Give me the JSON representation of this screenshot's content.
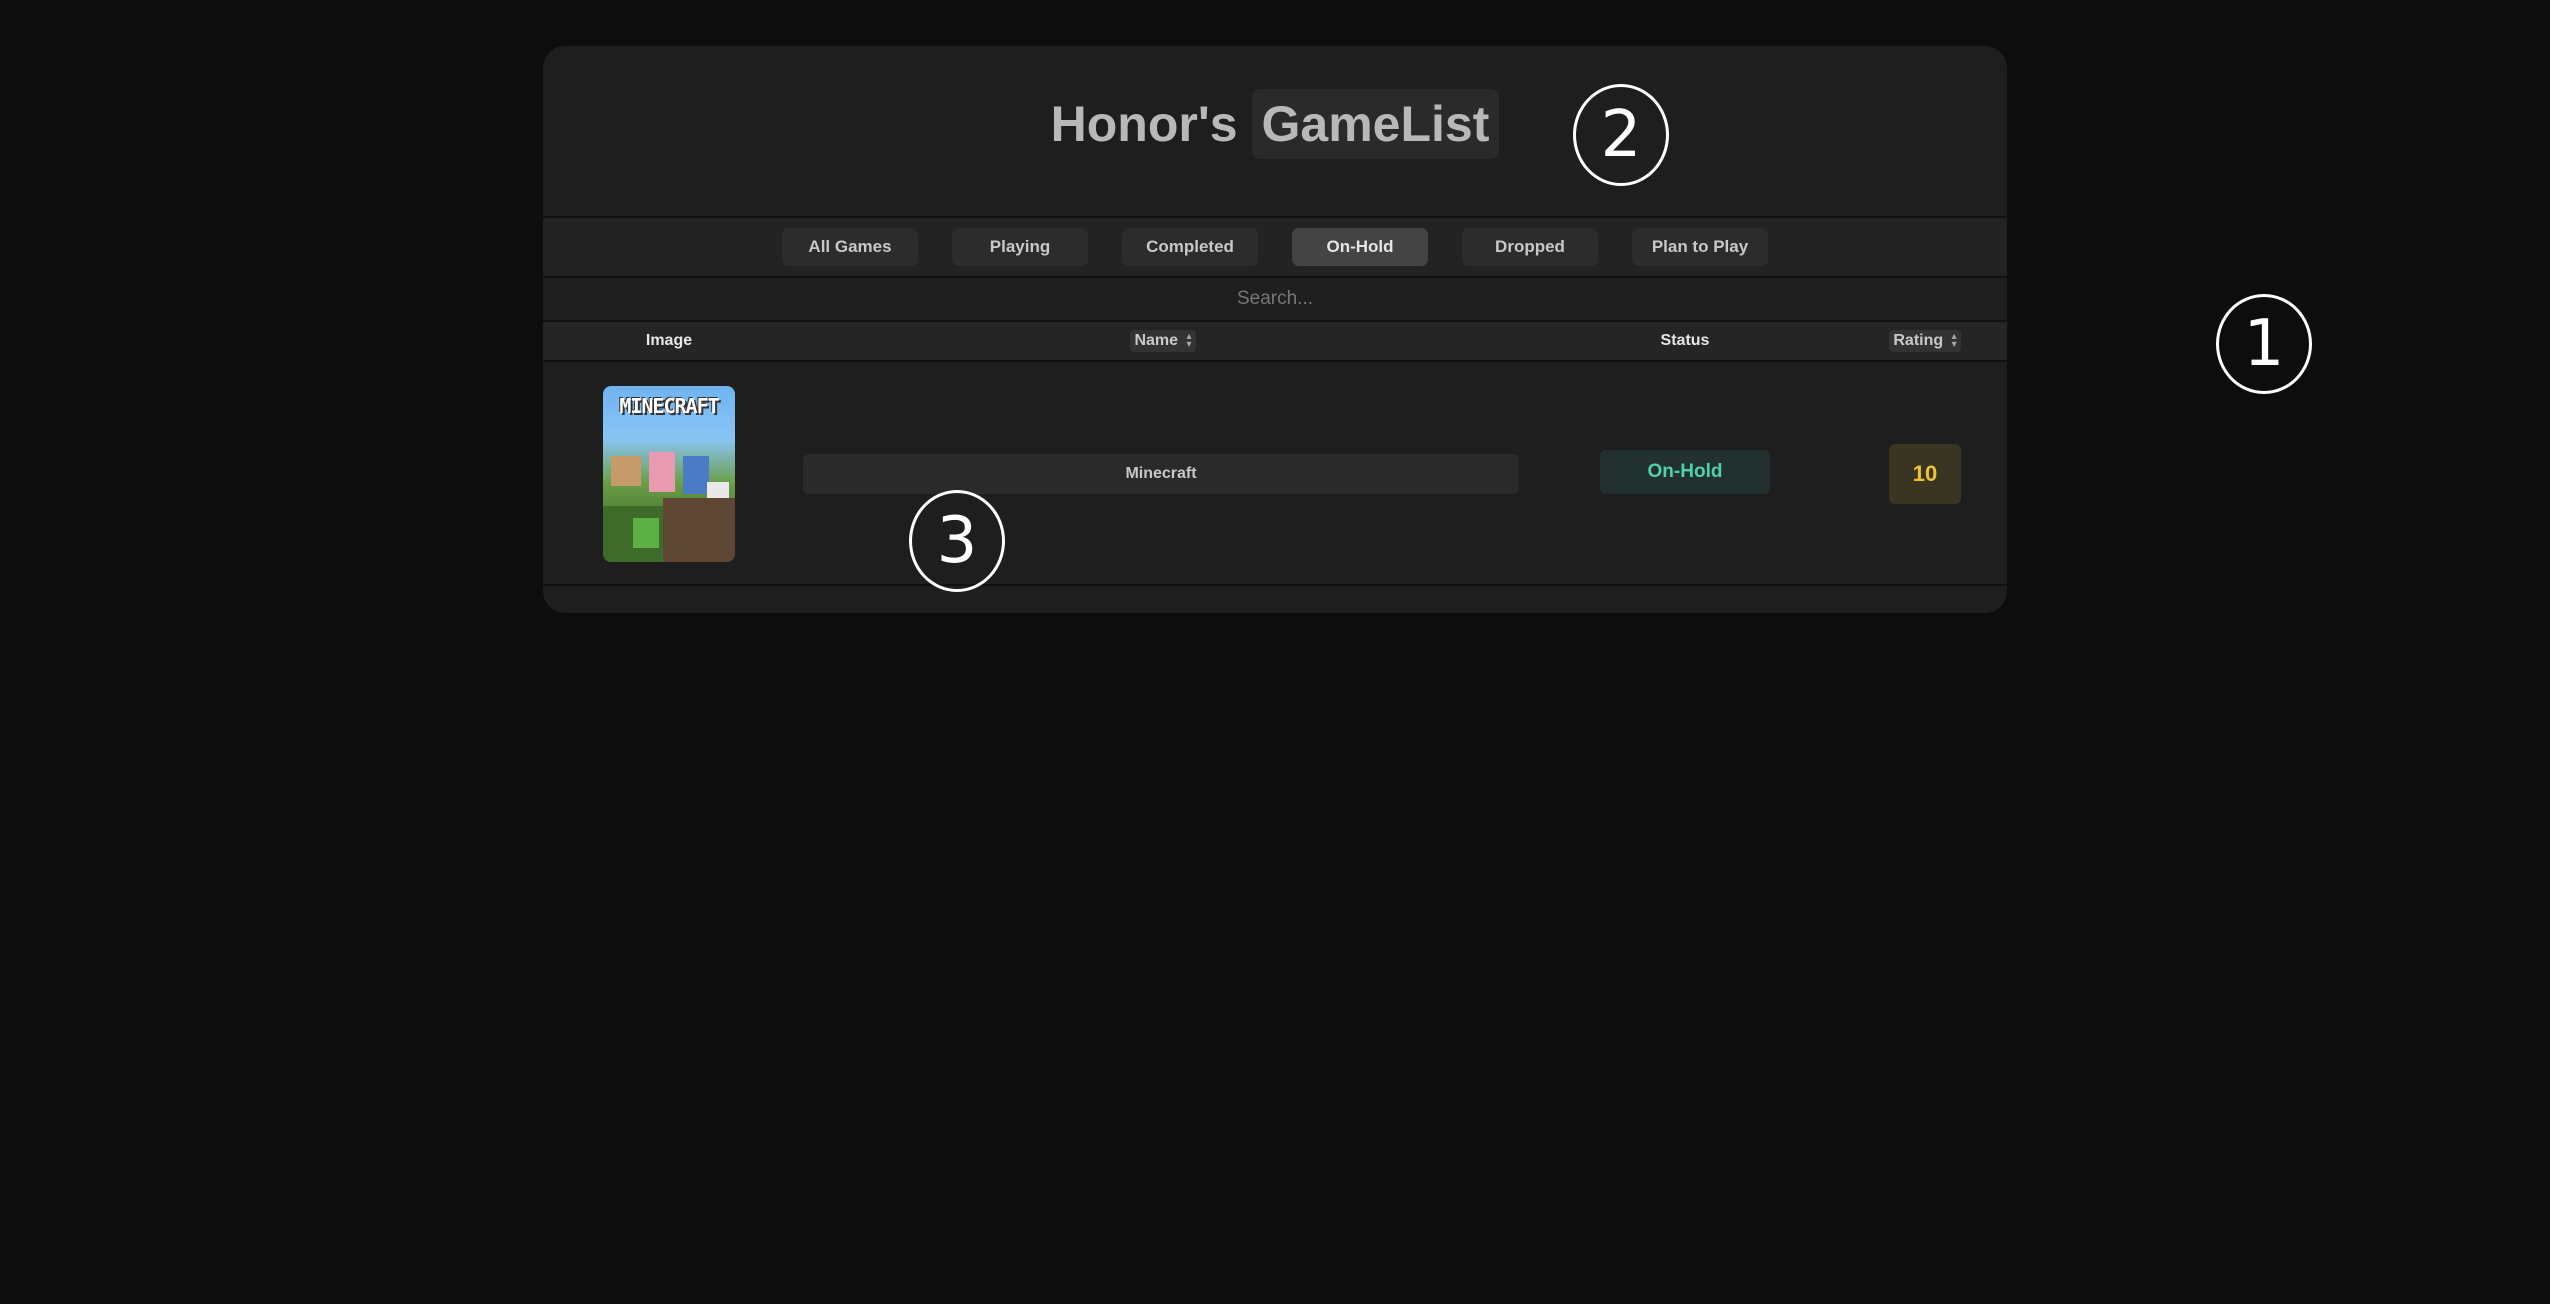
{
  "header": {
    "owner": "Honor's",
    "app_name": "GameList"
  },
  "filters": [
    {
      "label": "All Games",
      "active": false
    },
    {
      "label": "Playing",
      "active": false
    },
    {
      "label": "Completed",
      "active": false
    },
    {
      "label": "On-Hold",
      "active": true
    },
    {
      "label": "Dropped",
      "active": false
    },
    {
      "label": "Plan to Play",
      "active": false
    }
  ],
  "search": {
    "placeholder": "Search...",
    "value": ""
  },
  "table": {
    "columns": {
      "image": "Image",
      "name": "Name",
      "status": "Status",
      "rating": "Rating"
    },
    "sort_icon": "sort-updown-icon",
    "rows": [
      {
        "cover_logo": "MINECRAFT",
        "name": "Minecraft",
        "status": "On-Hold",
        "rating": "10"
      }
    ]
  },
  "markers": [
    "1",
    "2",
    "3"
  ],
  "colors": {
    "background": "#0d0d0d",
    "panel": "#1e1e1e",
    "status_onhold": "#4fd1a9",
    "rating": "#f0c230"
  }
}
